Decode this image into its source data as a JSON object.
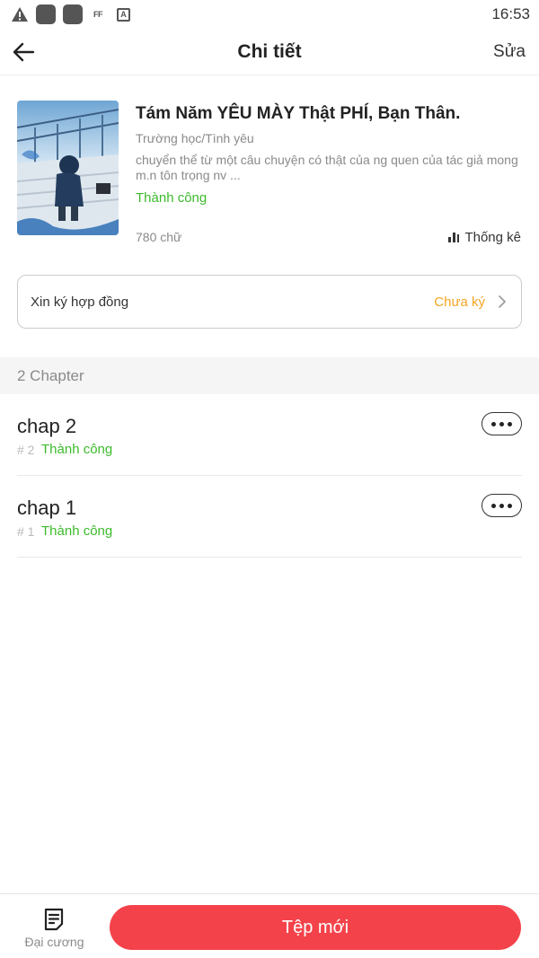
{
  "status_bar": {
    "time": "16:53",
    "icons": [
      "warning-icon",
      "app-square-icon",
      "app-square-icon",
      "ff-icon",
      "font-a-icon"
    ]
  },
  "header": {
    "title": "Chi tiết",
    "edit_label": "Sửa",
    "back_icon": "arrow-left-icon"
  },
  "book": {
    "title": "Tám Năm YÊU MÀY Thật PHÍ, Bạn Thân.",
    "genre": "Trường học/Tình yêu",
    "description": "chuyển thể từ một câu chuyện có thật của ng quen của tác giả mong m.n tôn trọng nv ...",
    "status": "Thành công",
    "word_count": "780 chữ",
    "stats_label": "Thống kê"
  },
  "contract": {
    "label": "Xin ký hợp đồng",
    "status": "Chưa ký"
  },
  "chapters_section": {
    "title": "2 Chapter",
    "items": [
      {
        "title": "chap 2",
        "number": "# 2",
        "status": "Thành công"
      },
      {
        "title": "chap 1",
        "number": "# 1",
        "status": "Thành công"
      }
    ]
  },
  "bottom_bar": {
    "outline_label": "Đại cương",
    "new_file_label": "Tệp mới"
  },
  "colors": {
    "accent_red": "#f4424a",
    "success_green": "#3cbb2c",
    "pending_orange": "#f5a523"
  }
}
